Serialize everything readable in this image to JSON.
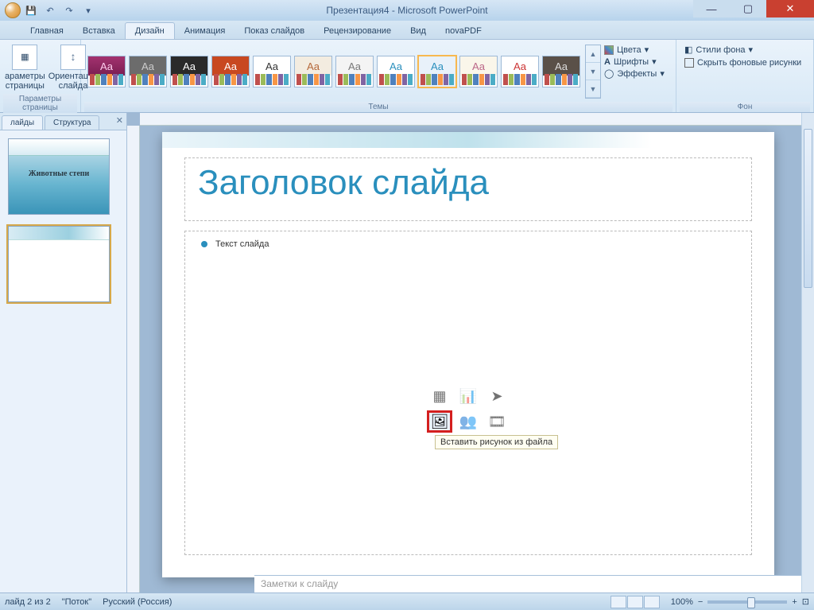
{
  "title": "Презентация4 - Microsoft PowerPoint",
  "tabs": [
    "Главная",
    "Вставка",
    "Дизайн",
    "Анимация",
    "Показ слайдов",
    "Рецензирование",
    "Вид",
    "novaPDF"
  ],
  "active_tab": "Дизайн",
  "ribbon": {
    "page_setup": {
      "label": "Параметры страницы",
      "page": "араметры\nстраницы",
      "orient": "Ориентация\nслайда"
    },
    "themes": {
      "label": "Темы",
      "colors": "Цвета",
      "fonts": "Шрифты",
      "effects": "Эффекты"
    },
    "background": {
      "label": "Фон",
      "styles": "Стили фона",
      "hide": "Скрыть фоновые рисунки"
    }
  },
  "left_panel": {
    "tabs": [
      "лайды",
      "Структура"
    ],
    "slide1_title": "Животные степи"
  },
  "slide": {
    "title": "Заголовок слайда",
    "body": "Текст слайда",
    "tooltip": "Вставить рисунок из файла"
  },
  "notes_placeholder": "Заметки к слайду",
  "status": {
    "slide": "лайд 2 из 2",
    "theme": "\"Поток\"",
    "lang": "Русский (Россия)",
    "zoom": "100%"
  }
}
